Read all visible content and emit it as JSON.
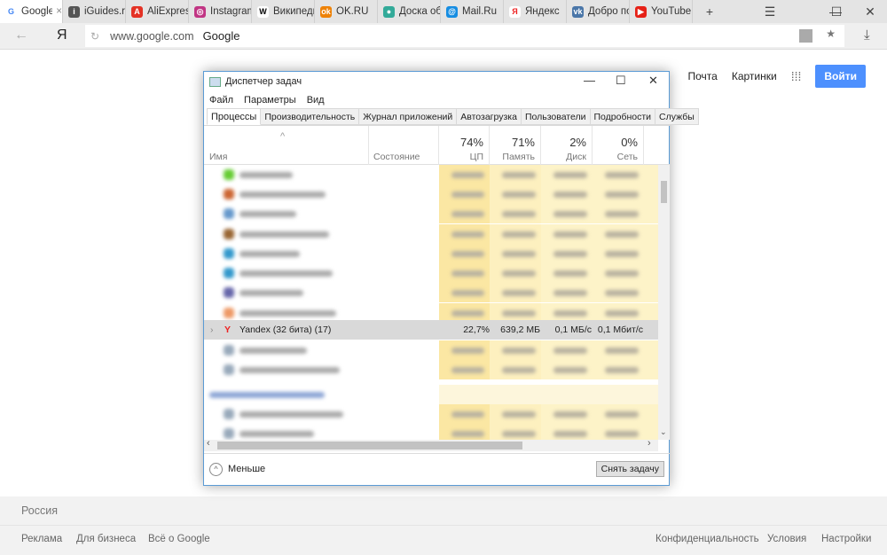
{
  "browser": {
    "tabs": [
      {
        "label": "Google",
        "color": "#4285f4",
        "glyph": "G"
      },
      {
        "label": "iGuides.ru",
        "color": "#555",
        "glyph": "i"
      },
      {
        "label": "AliExpress",
        "color": "#e43225",
        "glyph": "A"
      },
      {
        "label": "Instagram",
        "color": "#c13584",
        "glyph": "◎"
      },
      {
        "label": "Википедия",
        "color": "#fff",
        "glyph": "W"
      },
      {
        "label": "OK.RU",
        "color": "#ee8208",
        "glyph": "ok"
      },
      {
        "label": "Доска объявлений",
        "color": "#3a9",
        "glyph": "●"
      },
      {
        "label": "Mail.Ru",
        "color": "#168de2",
        "glyph": "@"
      },
      {
        "label": "Яндекс",
        "color": "#fff",
        "glyph": "Я"
      },
      {
        "label": "Добро пожаловать",
        "color": "#4a76a8",
        "glyph": "vk"
      },
      {
        "label": "YouTube",
        "color": "#e62117",
        "glyph": "▶"
      }
    ],
    "new_tab": "+",
    "logo": "Я",
    "url": "www.google.com",
    "page_title": "Google"
  },
  "google": {
    "mail": "Почта",
    "images": "Картинки",
    "signin": "Войти",
    "region": "Россия",
    "footer_left": [
      "Реклама",
      "Для бизнеса",
      "Всё о Google"
    ],
    "footer_right": [
      "Конфиденциальность",
      "Условия",
      "Настройки"
    ]
  },
  "taskmgr": {
    "title": "Диспетчер задач",
    "menu": [
      "Файл",
      "Параметры",
      "Вид"
    ],
    "tabs": [
      "Процессы",
      "Производительность",
      "Журнал приложений",
      "Автозагрузка",
      "Пользователи",
      "Подробности",
      "Службы"
    ],
    "columns": {
      "name": "Имя",
      "status": "Состояние",
      "cpu_pct": "74%",
      "cpu": "ЦП",
      "mem_pct": "71%",
      "mem": "Память",
      "disk_pct": "2%",
      "disk": "Диск",
      "net_pct": "0%",
      "net": "Сеть"
    },
    "selected_process": {
      "name": "Yandex (32 бита) (17)",
      "cpu": "22,7%",
      "mem": "639,2 МБ",
      "disk": "0,1 МБ/с",
      "net": "0,1 Мбит/с"
    },
    "fewer": "Меньше",
    "end_task": "Снять задачу"
  }
}
